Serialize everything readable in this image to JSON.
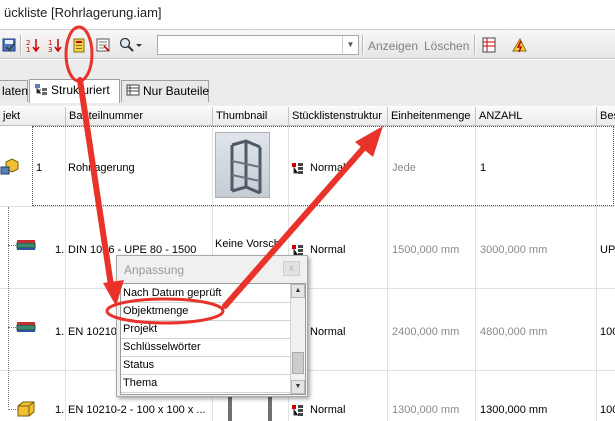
{
  "window": {
    "title": "ückliste [Rohrlagerung.iam]"
  },
  "toolbar": {
    "icons": [
      "save-icon",
      "sort-descending-icon",
      "sort-ascending-icon",
      "customize-icon",
      "export-icon",
      "find-icon",
      "bom-table-icon",
      "update-icon"
    ],
    "combo_value": "",
    "show_label": "Anzeigen",
    "clear_label": "Löschen"
  },
  "tabs": [
    {
      "label": "laten"
    },
    {
      "label": "Strukturiert"
    },
    {
      "label": "Nur Bauteile"
    }
  ],
  "grid": {
    "columns": [
      "jekt",
      "Bauteilnummer",
      "Thumbnail",
      "Stücklistenstruktur",
      "Einheitenmenge",
      "ANZAHL",
      "Bes"
    ],
    "rows": [
      {
        "item": "1",
        "part": "Rohrlagerung",
        "thumbnail": "",
        "structure": "Normal",
        "unit_qty": "Jede",
        "qty": "1",
        "extra": ""
      },
      {
        "item": "1.",
        "part": "DIN 1026 - UPE 80 - 1500",
        "thumbnail": "Keine Vorsch",
        "structure": "Normal",
        "unit_qty": "1500,000 mm",
        "qty": "3000,000 mm",
        "extra": "UPE"
      },
      {
        "item": "1.",
        "part": "EN 10210",
        "thumbnail": "",
        "structure": "Normal",
        "unit_qty": "2400,000 mm",
        "qty": "4800,000 mm",
        "extra": "100"
      },
      {
        "item": "1.",
        "part": "EN 10210-2 - 100 x 100 x ...",
        "thumbnail": "",
        "structure": "Normal",
        "unit_qty": "1300,000 mm",
        "qty": "1300,000 mm",
        "extra": "100"
      }
    ]
  },
  "popup": {
    "title": "Anpassung",
    "close_label": "x",
    "items": [
      "Nach Datum geprüft",
      "Objektmenge",
      "Projekt",
      "Schlüsselwörter",
      "Status",
      "Thema"
    ],
    "highlighted": "Objektmenge"
  },
  "colors": {
    "annotation": "#e8322a",
    "toolbar_bg": "#ececec"
  }
}
